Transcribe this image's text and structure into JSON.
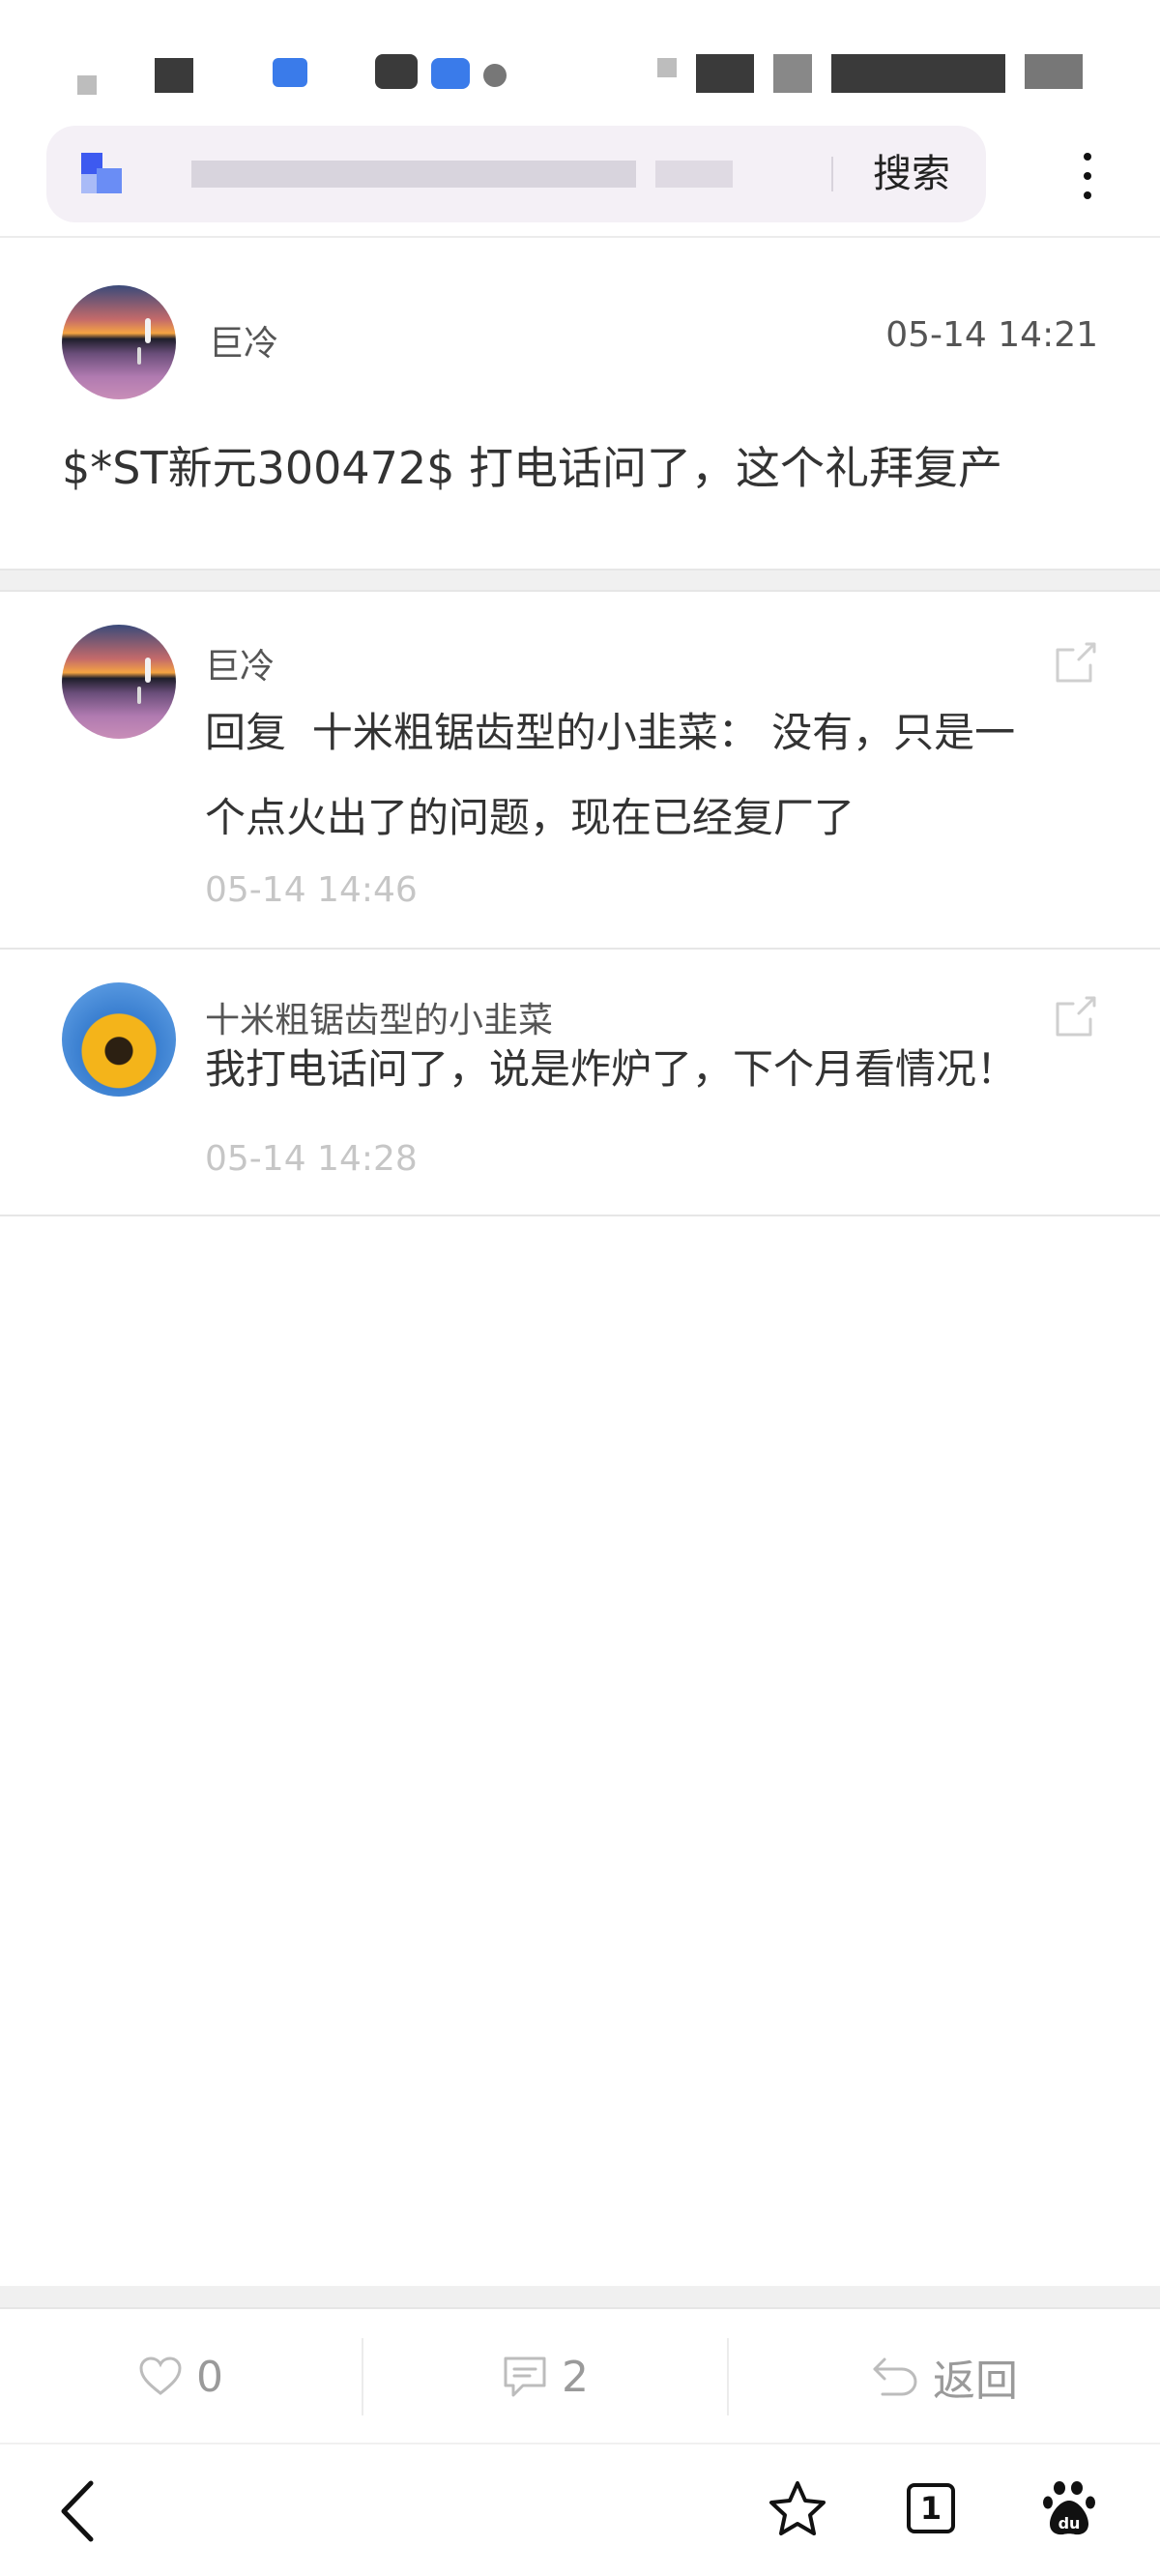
{
  "search_bar": {
    "search_label": "搜索"
  },
  "post": {
    "author": "巨冷",
    "time": "05-14 14:21",
    "content": "$*ST新元300472$ 打电话问了，这个礼拜复产"
  },
  "replies": [
    {
      "author": "巨冷",
      "reply_prefix": "回复",
      "reply_to": "十米粗锯齿型的小韭菜",
      "text_line1": "：  没有，只是一",
      "text_line2": "个点火出了的问题，现在已经复厂了",
      "time": "05-14 14:46",
      "avatar": "sunset-heron-avatar"
    },
    {
      "author": "十米粗锯齿型的小韭菜",
      "text_line1": "我打电话问了，说是炸炉了，下个月看情况！",
      "time": "05-14 14:28",
      "avatar": "sunflower-avatar"
    }
  ],
  "action_bar": {
    "like_count": "0",
    "comment_count": "2",
    "back_label": "返回"
  },
  "browser_nav": {
    "tab_count": "1"
  },
  "icons": {
    "like": "heart-icon",
    "comment": "comment-icon",
    "back": "return-arrow-icon",
    "nav_back": "chevron-left-icon",
    "bookmark": "star-icon",
    "tabs": "tab-count-icon",
    "baidu": "baidu-paw-icon",
    "share": "share-icon",
    "more": "more-vertical-icon"
  },
  "colors": {
    "primary_text": "#333333",
    "secondary_text": "#555555",
    "muted_text": "#c6c6c6",
    "action_text": "#9a9a9a",
    "search_bg": "#f4f0f6"
  }
}
